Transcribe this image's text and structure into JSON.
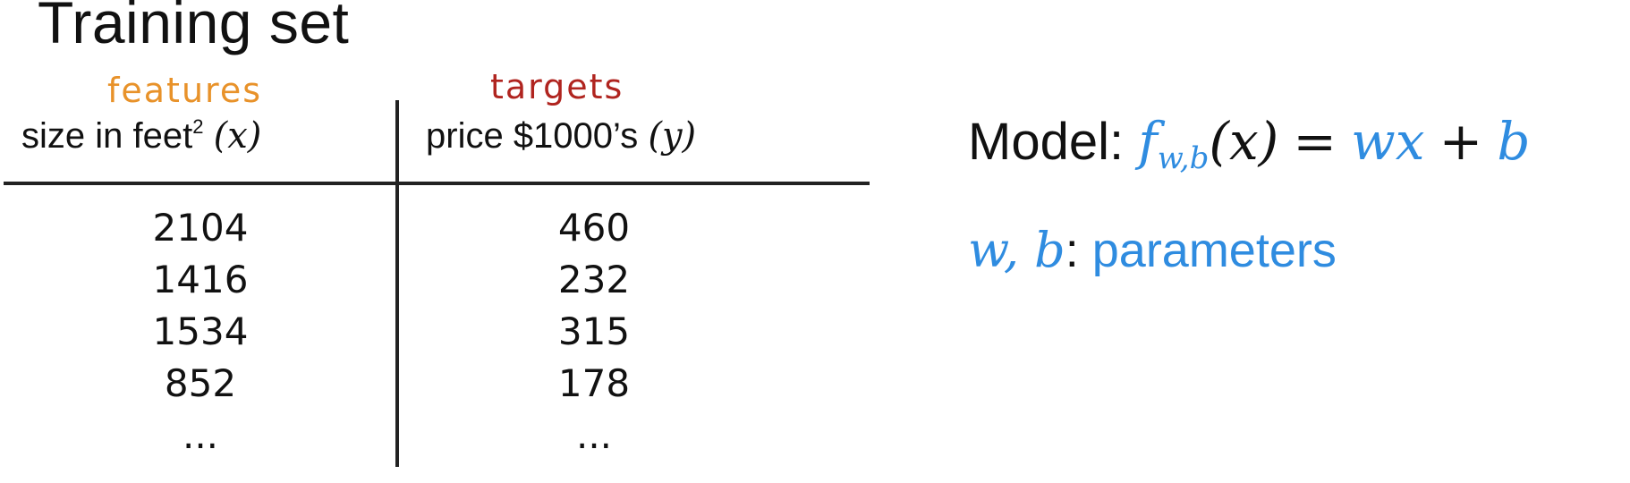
{
  "title": "Training set",
  "annotations": {
    "features": "features",
    "targets": "targets"
  },
  "table": {
    "columns": [
      {
        "label": "size in feet",
        "superscript": "2",
        "var": "(x)"
      },
      {
        "label": "price $1000’s",
        "var": "(y)"
      }
    ],
    "rows": [
      [
        "2104",
        "460"
      ],
      [
        "1416",
        "232"
      ],
      [
        "1534",
        "315"
      ],
      [
        "852",
        "178"
      ],
      [
        "...",
        "..."
      ]
    ]
  },
  "model": {
    "label": "Model:",
    "function": "f",
    "subscript": "w,b",
    "arg": "(x)",
    "equals": "=",
    "term1": "wx",
    "plus": "+",
    "term2": "b"
  },
  "params": {
    "vars": "w, b",
    "colon": ":",
    "label": "parameters"
  },
  "colors": {
    "accent_blue": "#2f8ce0",
    "features_orange": "#e8922a",
    "targets_red": "#b0241f"
  }
}
